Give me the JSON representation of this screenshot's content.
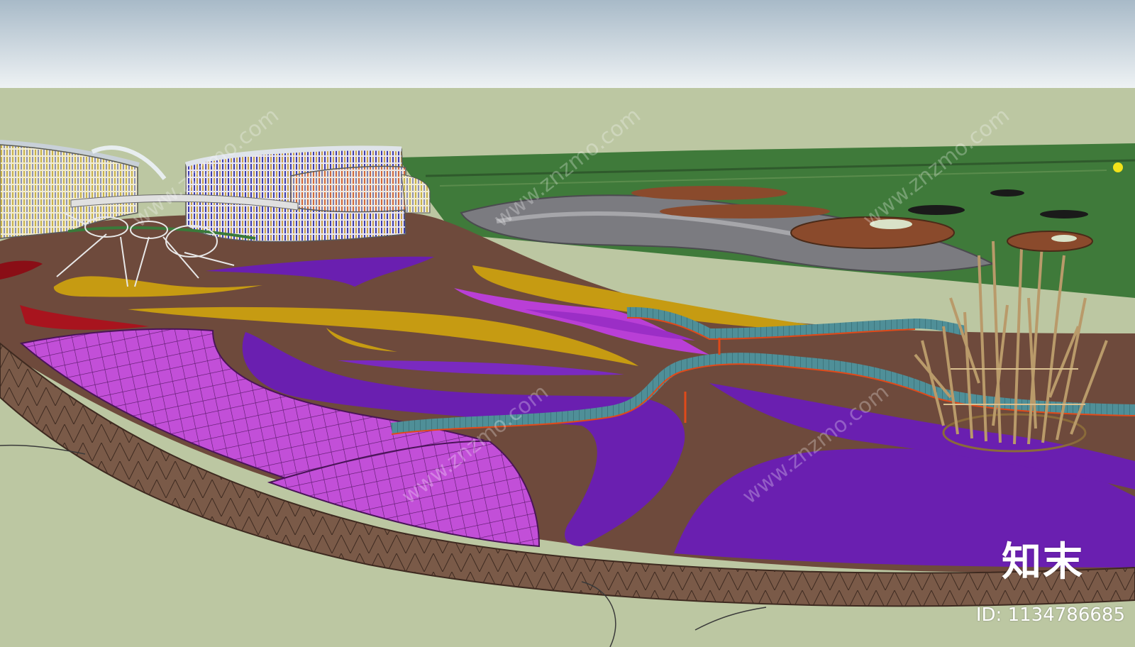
{
  "brand": {
    "logo": "知末",
    "image_id": "ID: 1134786685",
    "watermark": "www.znzmo.com"
  },
  "colors": {
    "sky_top": "#a7b9c7",
    "sky_bottom": "#e8eef2",
    "ground": "#bcc7a2",
    "lawn": "#3f7a3a",
    "soil": "#6e4a3c",
    "purple": "#6a1fb0",
    "magenta": "#b93fd6",
    "mustard": "#c69b12",
    "red": "#a8141e",
    "bridge": "#4a8c96",
    "bamboo": "#b99a6a"
  }
}
